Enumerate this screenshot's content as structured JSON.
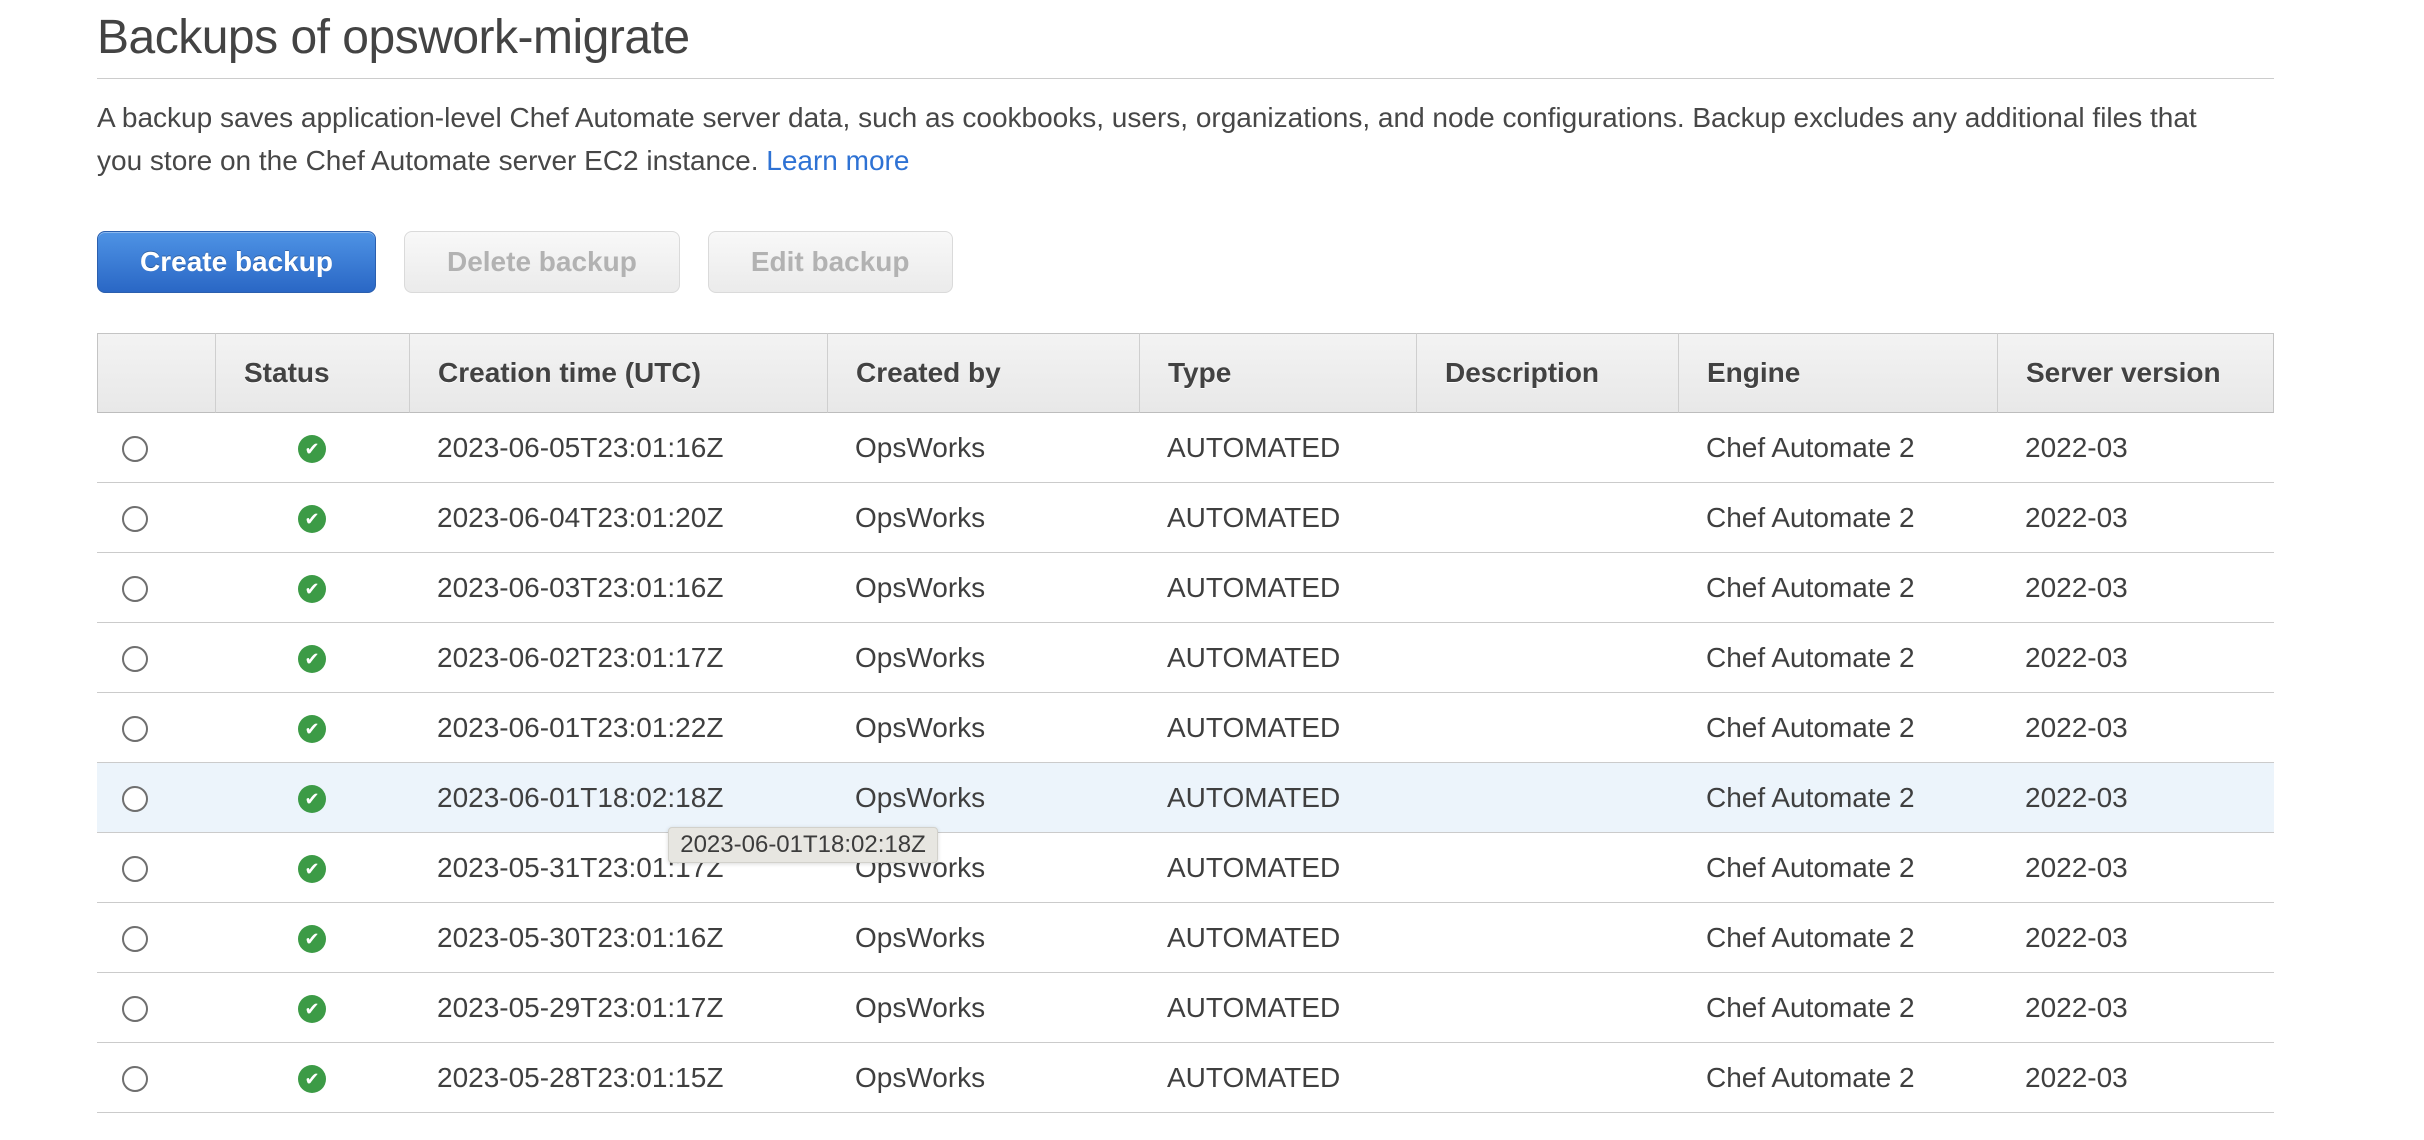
{
  "page": {
    "title": "Backups of opswork-migrate"
  },
  "description": {
    "line1": "A backup saves application-level Chef Automate server data, such as cookbooks, users, organizations, and node configurations. Backup excludes any additional files that",
    "line2": "you store on the Chef Automate server EC2 instance.",
    "link_label": "Learn more"
  },
  "toolbar": {
    "create_label": "Create backup",
    "delete_label": "Delete backup",
    "edit_label": "Edit backup"
  },
  "table": {
    "headers": {
      "select": "",
      "status": "Status",
      "creation_time": "Creation time (UTC)",
      "created_by": "Created by",
      "type": "Type",
      "description": "Description",
      "engine": "Engine",
      "server_version": "Server version"
    },
    "rows": [
      {
        "status": "healthy",
        "creation_time": "2023-06-05T23:01:16Z",
        "created_by": "OpsWorks",
        "type": "AUTOMATED",
        "description": "",
        "engine": "Chef Automate 2",
        "server_version": "2022-03"
      },
      {
        "status": "healthy",
        "creation_time": "2023-06-04T23:01:20Z",
        "created_by": "OpsWorks",
        "type": "AUTOMATED",
        "description": "",
        "engine": "Chef Automate 2",
        "server_version": "2022-03"
      },
      {
        "status": "healthy",
        "creation_time": "2023-06-03T23:01:16Z",
        "created_by": "OpsWorks",
        "type": "AUTOMATED",
        "description": "",
        "engine": "Chef Automate 2",
        "server_version": "2022-03"
      },
      {
        "status": "healthy",
        "creation_time": "2023-06-02T23:01:17Z",
        "created_by": "OpsWorks",
        "type": "AUTOMATED",
        "description": "",
        "engine": "Chef Automate 2",
        "server_version": "2022-03"
      },
      {
        "status": "healthy",
        "creation_time": "2023-06-01T23:01:22Z",
        "created_by": "OpsWorks",
        "type": "AUTOMATED",
        "description": "",
        "engine": "Chef Automate 2",
        "server_version": "2022-03"
      },
      {
        "status": "healthy",
        "creation_time": "2023-06-01T18:02:18Z",
        "created_by": "OpsWorks",
        "type": "AUTOMATED",
        "description": "",
        "engine": "Chef Automate 2",
        "server_version": "2022-03",
        "highlighted": true
      },
      {
        "status": "healthy",
        "creation_time": "2023-05-31T23:01:17Z",
        "created_by": "OpsWorks",
        "type": "AUTOMATED",
        "description": "",
        "engine": "Chef Automate 2",
        "server_version": "2022-03"
      },
      {
        "status": "healthy",
        "creation_time": "2023-05-30T23:01:16Z",
        "created_by": "OpsWorks",
        "type": "AUTOMATED",
        "description": "",
        "engine": "Chef Automate 2",
        "server_version": "2022-03"
      },
      {
        "status": "healthy",
        "creation_time": "2023-05-29T23:01:17Z",
        "created_by": "OpsWorks",
        "type": "AUTOMATED",
        "description": "",
        "engine": "Chef Automate 2",
        "server_version": "2022-03"
      },
      {
        "status": "healthy",
        "creation_time": "2023-05-28T23:01:15Z",
        "created_by": "OpsWorks",
        "type": "AUTOMATED",
        "description": "",
        "engine": "Chef Automate 2",
        "server_version": "2022-03"
      }
    ]
  },
  "tooltip": {
    "text": "2023-06-01T18:02:18Z"
  },
  "icons": {
    "status_ok": "check-circle-icon",
    "check_glyph": "✔"
  },
  "colors": {
    "primary_button_top": "#4e93e5",
    "primary_button_bottom": "#2a67c5",
    "link_blue": "#2e72d4",
    "status_green": "#3c9b46",
    "row_highlight": "#ecf4fb",
    "header_background": "#ededed"
  }
}
